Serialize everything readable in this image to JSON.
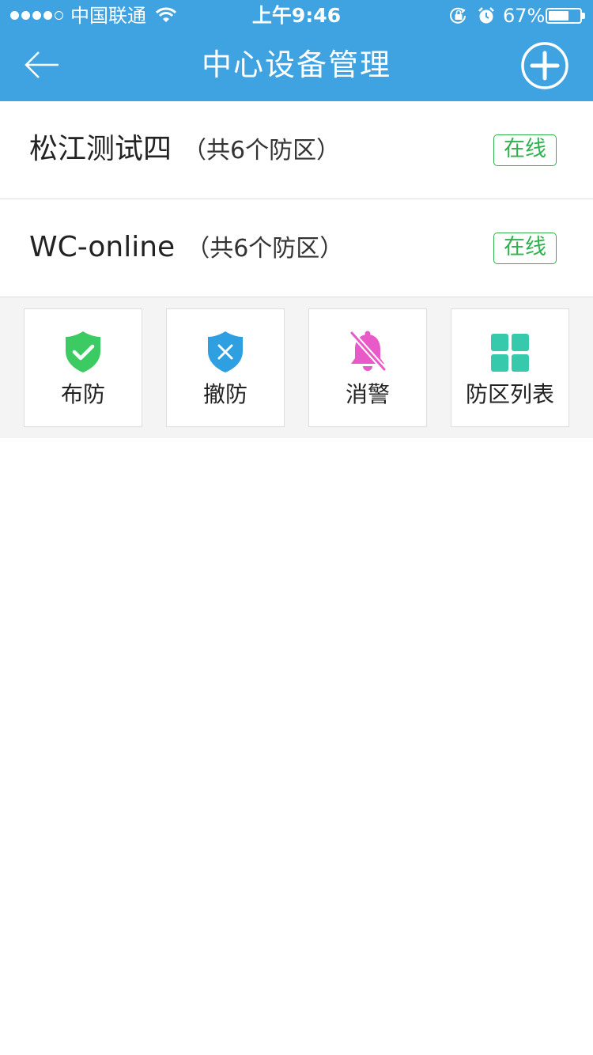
{
  "status_bar": {
    "carrier": "中国联通",
    "time": "上午9:46",
    "battery_percent": "67%",
    "battery_level": 0.67
  },
  "nav": {
    "title": "中心设备管理",
    "back_icon": "back-arrow-icon",
    "add_icon": "plus-circle-icon"
  },
  "devices": [
    {
      "name": "松江测试四",
      "zones": "（共6个防区）",
      "status": "在线"
    },
    {
      "name": "WC-online",
      "zones": "（共6个防区）",
      "status": "在线"
    }
  ],
  "actions": [
    {
      "label": "布防",
      "icon": "shield-check-icon",
      "color": "#3CCB63"
    },
    {
      "label": "撤防",
      "icon": "shield-x-icon",
      "color": "#2E9FE0"
    },
    {
      "label": "消警",
      "icon": "bell-off-icon",
      "color": "#E85AC8"
    },
    {
      "label": "防区列表",
      "icon": "grid-icon",
      "color": "#37C9AC"
    }
  ],
  "colors": {
    "header": "#3FA2E1",
    "online": "#2EB14E"
  }
}
